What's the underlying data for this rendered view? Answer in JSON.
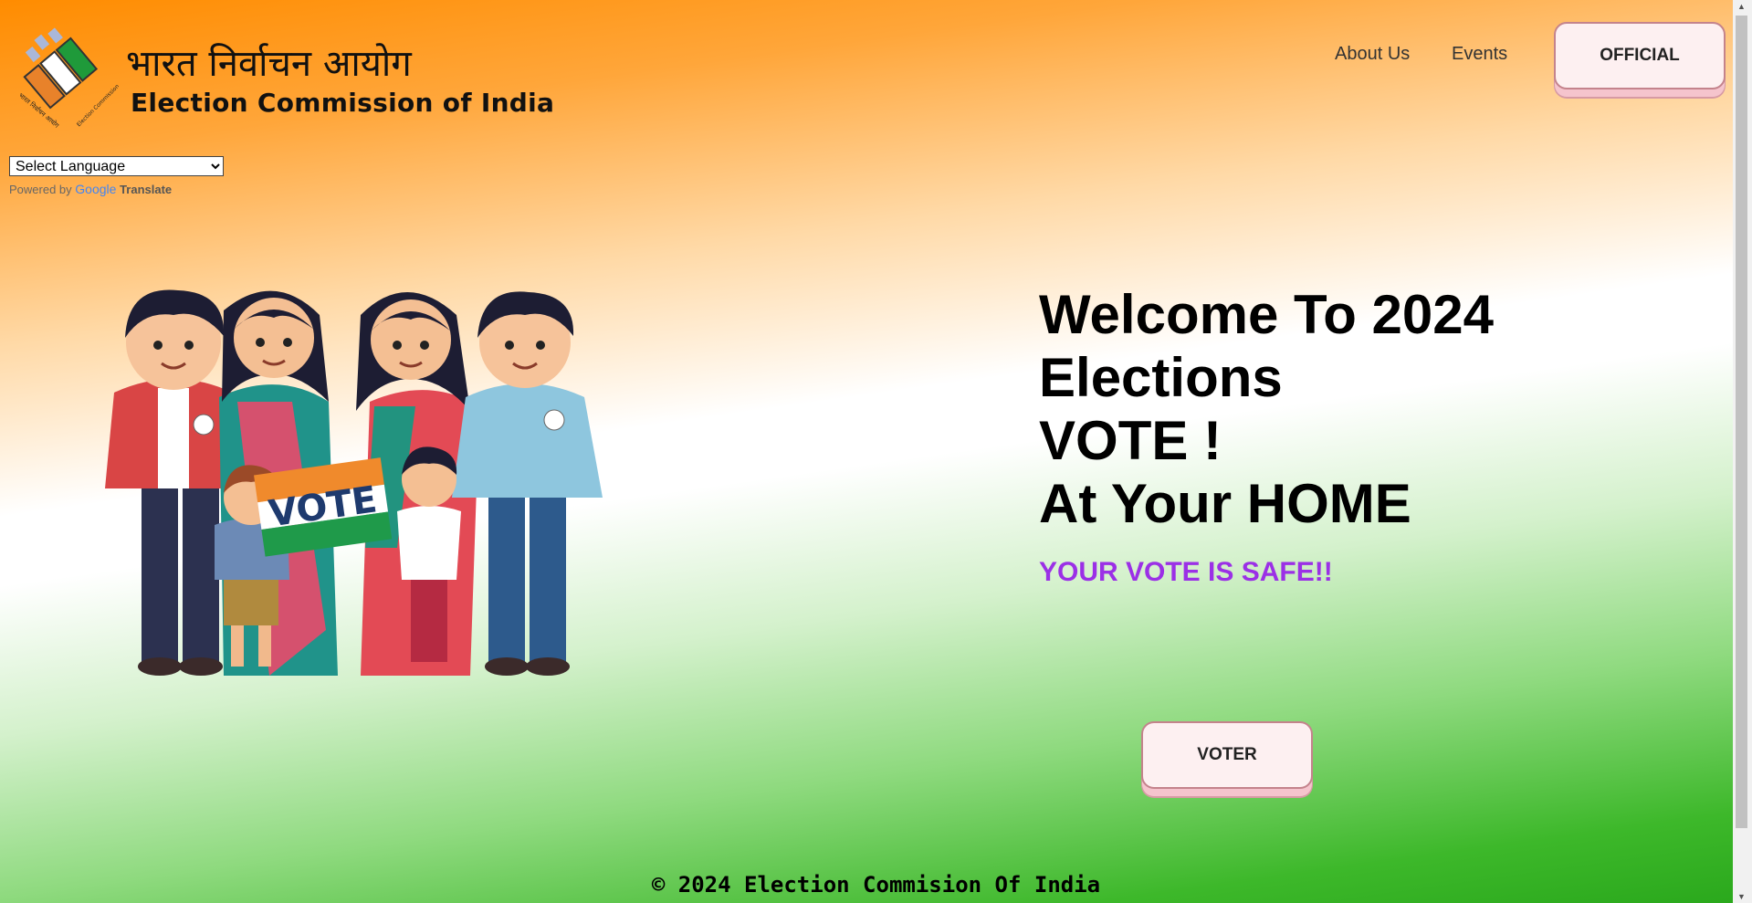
{
  "brand": {
    "hindi_title": "भारत निर्वाचन आयोग",
    "english_title": "Election Commission of India",
    "logo_text_left": "भारत निर्वाचन आयोग",
    "logo_text_right": "Election Commission of India"
  },
  "nav": {
    "about": "About Us",
    "events": "Events",
    "official_button": "OFFICIAL"
  },
  "translate": {
    "select_value": "Select Language",
    "powered_by": "Powered by",
    "google": "Google",
    "translate": "Translate"
  },
  "hero": {
    "illustration_banner": "VOTE",
    "line1": "Welcome To 2024",
    "line2": "Elections",
    "line3": "VOTE !",
    "line4": "At Your HOME",
    "tagline": "YOUR VOTE IS SAFE!!",
    "voter_button": "VOTER"
  },
  "footer": {
    "copyright": "© 2024 Election Commision Of India"
  },
  "colors": {
    "saffron": "#ff8c00",
    "green": "#2aa81c",
    "tagline": "#9b30e6",
    "button_bg": "#fdf0f1",
    "button_border": "#c4838c"
  }
}
